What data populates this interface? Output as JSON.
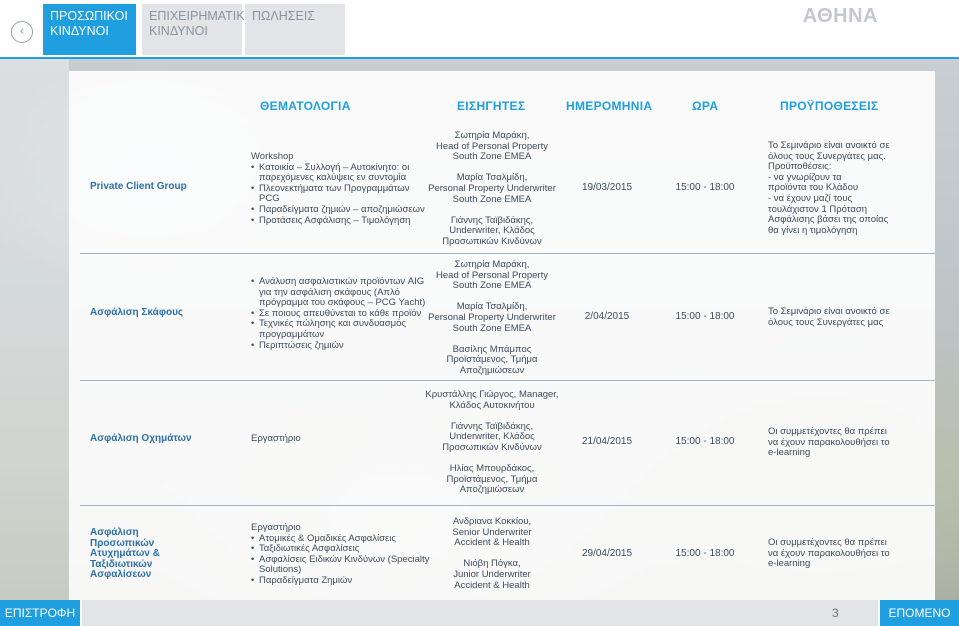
{
  "header": {
    "back_icon": "chevron-left-icon",
    "tabs": [
      {
        "line1": "ΠΡΟΣΩΠΙΚΟΙ",
        "line2": "ΚΙΝΔΥΝΟΙ",
        "active": true
      },
      {
        "line1": "ΕΠΙΧΕΙΡΗΜΑΤΙΚΟΙ",
        "line2": "ΚΙΝΔΥΝΟΙ",
        "active": false
      },
      {
        "line1": "ΠΩΛΗΣΕΙΣ",
        "line2": "",
        "active": false
      }
    ],
    "city": "ΑΘΗΝΑ"
  },
  "table": {
    "columns": [
      "ΘΕΜΑΤΟΛΟΓΙΑ",
      "ΕΙΣΗΓΗΤΕΣ",
      "ΗΜΕΡΟΜΗΝΙΑ",
      "ΩΡΑ",
      "ΠΡΟΫΠΟΘΕΣΕΙΣ"
    ],
    "rows": [
      {
        "title": [
          "Private Client Group"
        ],
        "topic_intro": "Workshop",
        "topics": [
          "Κατοικία – Συλλογή – Αυτοκίνητο: οι παρεχόμενες καλύψεις εν συντομία",
          "Πλεονεκτήματα των Προγραμμάτων PCG",
          "Παραδείγματα ζημιών – αποζημιώσεων",
          "Προτάσεις Ασφάλισης – Τιμολόγηση"
        ],
        "speakers": [
          [
            "Σωτηρία Μαράκη,",
            "Head of Personal Property",
            "South Zone EMEA"
          ],
          [
            "Μαρία Τσαλμίδη,",
            "Personal Property Underwriter",
            "South Zone EMEA"
          ],
          [
            "Γιάννης Ταϊβιδάκης,",
            "Underwriter, Κλάδος",
            "Προσωπικών Κινδύνων"
          ]
        ],
        "date": "19/03/2015",
        "time": "15:00 - 18:00",
        "prereq": [
          "Το Σεμινάριο είναι ανοικτό σε",
          "όλους τους Συνεργάτες μας.",
          "Προϋποθέσεις:",
          "- να γνωρίζουν τα",
          "προϊόντα του Κλάδου",
          "- να έχουν μαζί τους",
          "τουλάχιστον 1 Πρόταση",
          "Ασφάλισης βάσει της οποίας",
          "θα γίνει η τιμολόγηση"
        ]
      },
      {
        "title": [
          "Ασφάλιση Σκάφους"
        ],
        "topic_intro": "",
        "topics": [
          "Ανάλυση ασφαλιστικών προϊόντων AIG για την ασφάλιση σκάφους (Απλό πρόγραμμα του σκάφους – PCG Yacht)",
          "Σε ποιους απευθύνεται το κάθε προϊόν",
          "Τεχνικές πώλησης και συνδυασμός προγραμμάτων",
          "Περιπτώσεις ζημιών"
        ],
        "speakers": [
          [
            "Σωτηρία Μαράκη,",
            "Head of Personal Property",
            "South Zone EMEA"
          ],
          [
            "Μαρία Τσαλμίδη,",
            "Personal Property Underwriter",
            "South Zone EMEA"
          ],
          [
            "Βασίλης Μπάμπος",
            "Προϊστάμενος, Τμήμα",
            "Αποζημιώσεων"
          ]
        ],
        "date": "2/04/2015",
        "time": "15:00 - 18:00",
        "prereq": [
          "Το Σεμινάριο είναι ανοικτό σε",
          "όλους τους Συνεργάτες μας"
        ]
      },
      {
        "title": [
          "Ασφάλιση Οχημάτων"
        ],
        "topic_intro": "Εργαστήριο",
        "topics": [],
        "speakers": [
          [
            "Κρυστάλλης Γιώργος, Manager,",
            "Κλάδος Αυτοκινήτου"
          ],
          [
            "Γιάννης Ταϊβιδάκης,",
            "Underwriter, Κλάδος",
            "Προσωπικών Κινδύνων"
          ],
          [
            "Ηλίας Μπουρδάκος,",
            "Προϊστάμενος, Τμήμα",
            "Αποζημιώσεων"
          ]
        ],
        "date": "21/04/2015",
        "time": "15:00 - 18:00",
        "prereq": [
          "Οι συμμετέχοντες θα πρέπει",
          "να έχουν παρακολουθήσει το",
          "e-learning"
        ]
      },
      {
        "title": [
          "Ασφάλιση",
          "Προσωπικών",
          "Ατυχημάτων &",
          "Ταξιδιωτικών",
          "Ασφαλίσεων"
        ],
        "topic_intro": "Εργαστήριο",
        "topics": [
          "Ατομικές & Ομαδικές Ασφαλίσεις",
          "Ταξιδιωτικές Ασφαλίσεις",
          "Ασφαλίσεις Ειδικών Κινδύνων (Specialty Solutions)",
          "Παραδείγματα Ζημιών"
        ],
        "speakers": [
          [
            "Ανδριανα Κοκκίου,",
            "Senior Underwriter",
            "Accident & Health"
          ],
          [
            "Νιόβη Πόγκα,",
            "Junior Underwriter",
            "Accident & Health"
          ]
        ],
        "date": "29/04/2015",
        "time": "15:00 - 18:00",
        "prereq": [
          "Οι συμμετέχοντες θα πρέπει",
          "να έχουν παρακολουθήσει το",
          "e-learning"
        ]
      }
    ]
  },
  "footer": {
    "back_label": "ΕΠΙΣΤΡΟΦΗ",
    "page": "3",
    "next_label": "ΕΠΟΜΕΝΟ"
  },
  "colors": {
    "accent": "#1f9fe0",
    "title_text": "#2d6fa6",
    "body_text": "#3d4b5a",
    "inactive_tab": "#e2e4e7"
  }
}
